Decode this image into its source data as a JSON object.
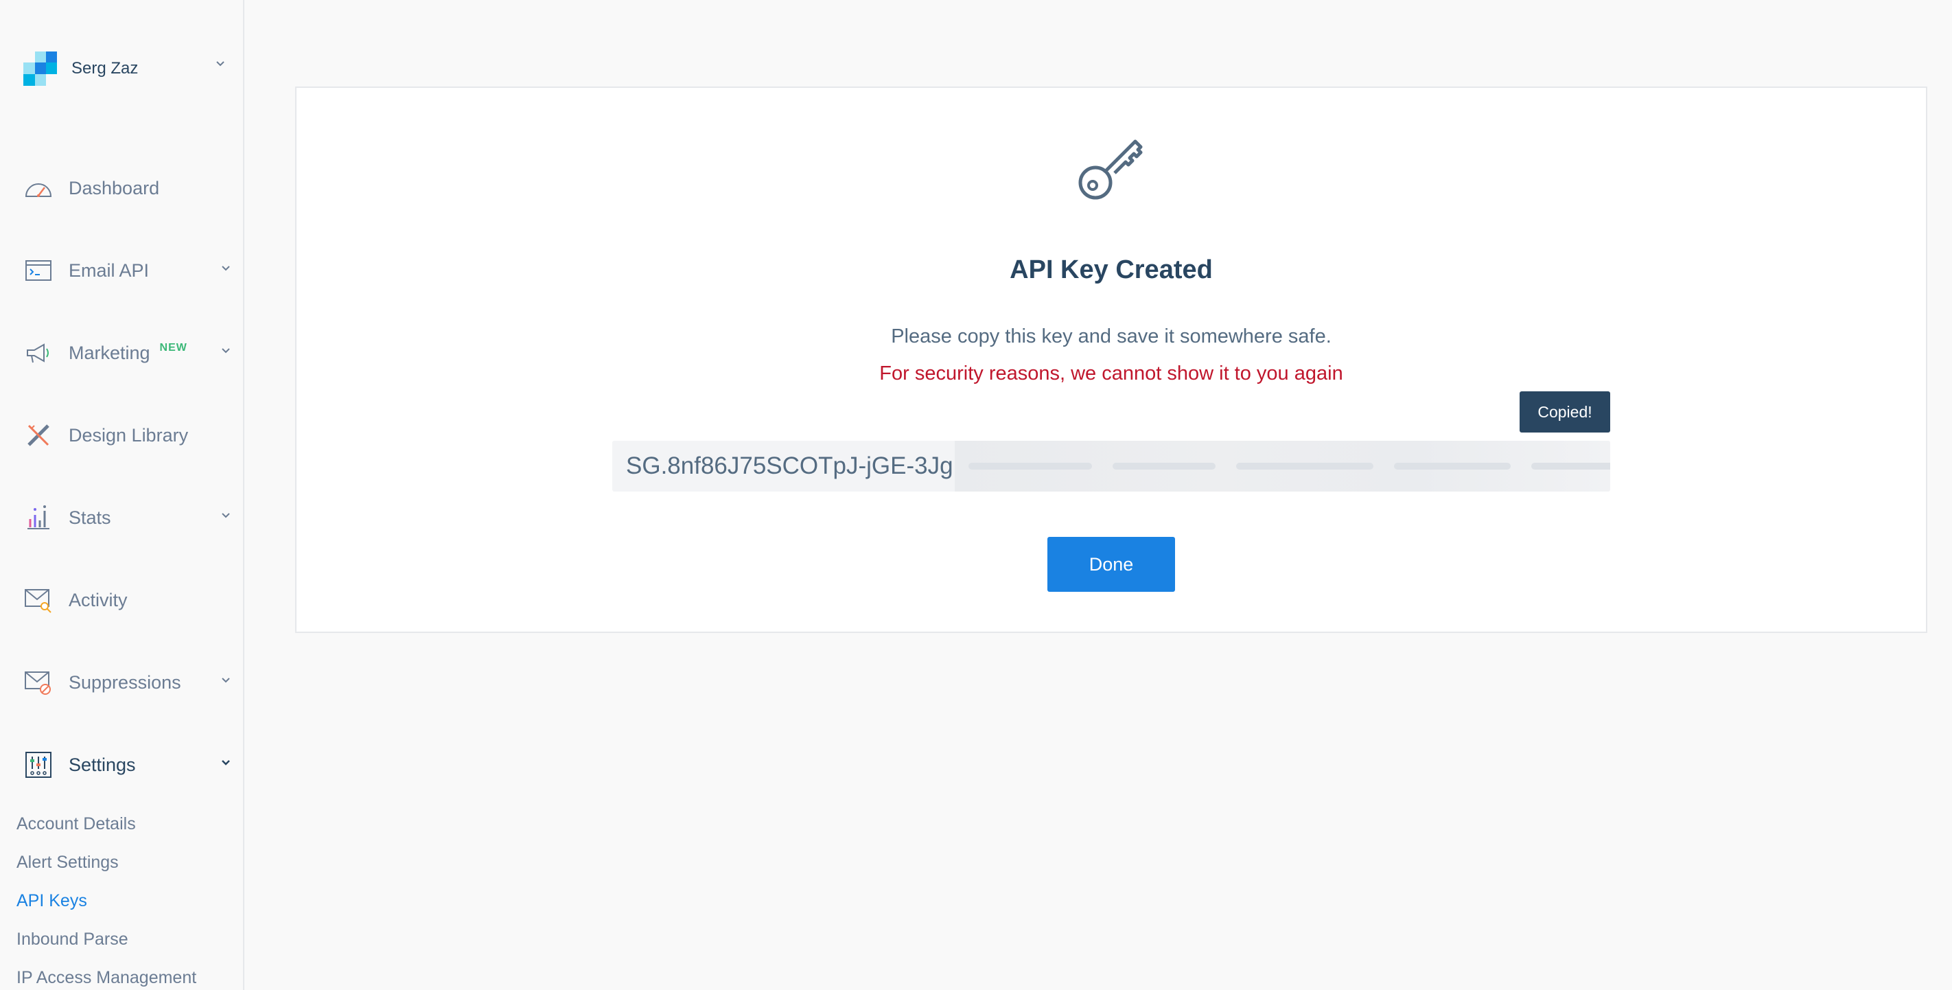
{
  "account": {
    "name": "Serg Zaz"
  },
  "nav": {
    "items": [
      {
        "label": "Dashboard",
        "icon": "dashboard-gauge-icon"
      },
      {
        "label": "Email API",
        "icon": "email-api-terminal-icon"
      },
      {
        "label": "Marketing",
        "icon": "marketing-megaphone-icon",
        "badge": "NEW"
      },
      {
        "label": "Design Library",
        "icon": "design-library-pencil-ruler-icon"
      },
      {
        "label": "Stats",
        "icon": "stats-bar-chart-icon"
      },
      {
        "label": "Activity",
        "icon": "activity-envelope-search-icon"
      },
      {
        "label": "Suppressions",
        "icon": "suppressions-envelope-blocked-icon"
      },
      {
        "label": "Settings",
        "icon": "settings-sliders-icon"
      }
    ],
    "settings_sub": [
      {
        "label": "Account Details"
      },
      {
        "label": "Alert Settings"
      },
      {
        "label": "API Keys"
      },
      {
        "label": "Inbound Parse"
      },
      {
        "label": "IP Access Management"
      }
    ]
  },
  "card": {
    "title": "API Key Created",
    "message": "Please copy this key and save it somewhere safe.",
    "warning": "For security reasons, we cannot show it to you again",
    "tooltip": "Copied!",
    "api_key_visible": "SG.8nf86J75SCOTpJ-jGE-3Jg",
    "done_label": "Done"
  },
  "colors": {
    "primary": "#1a82e2",
    "heading": "#294661",
    "warning": "#c0162c",
    "new_badge": "#3cb878",
    "tooltip_bg": "#294661"
  }
}
